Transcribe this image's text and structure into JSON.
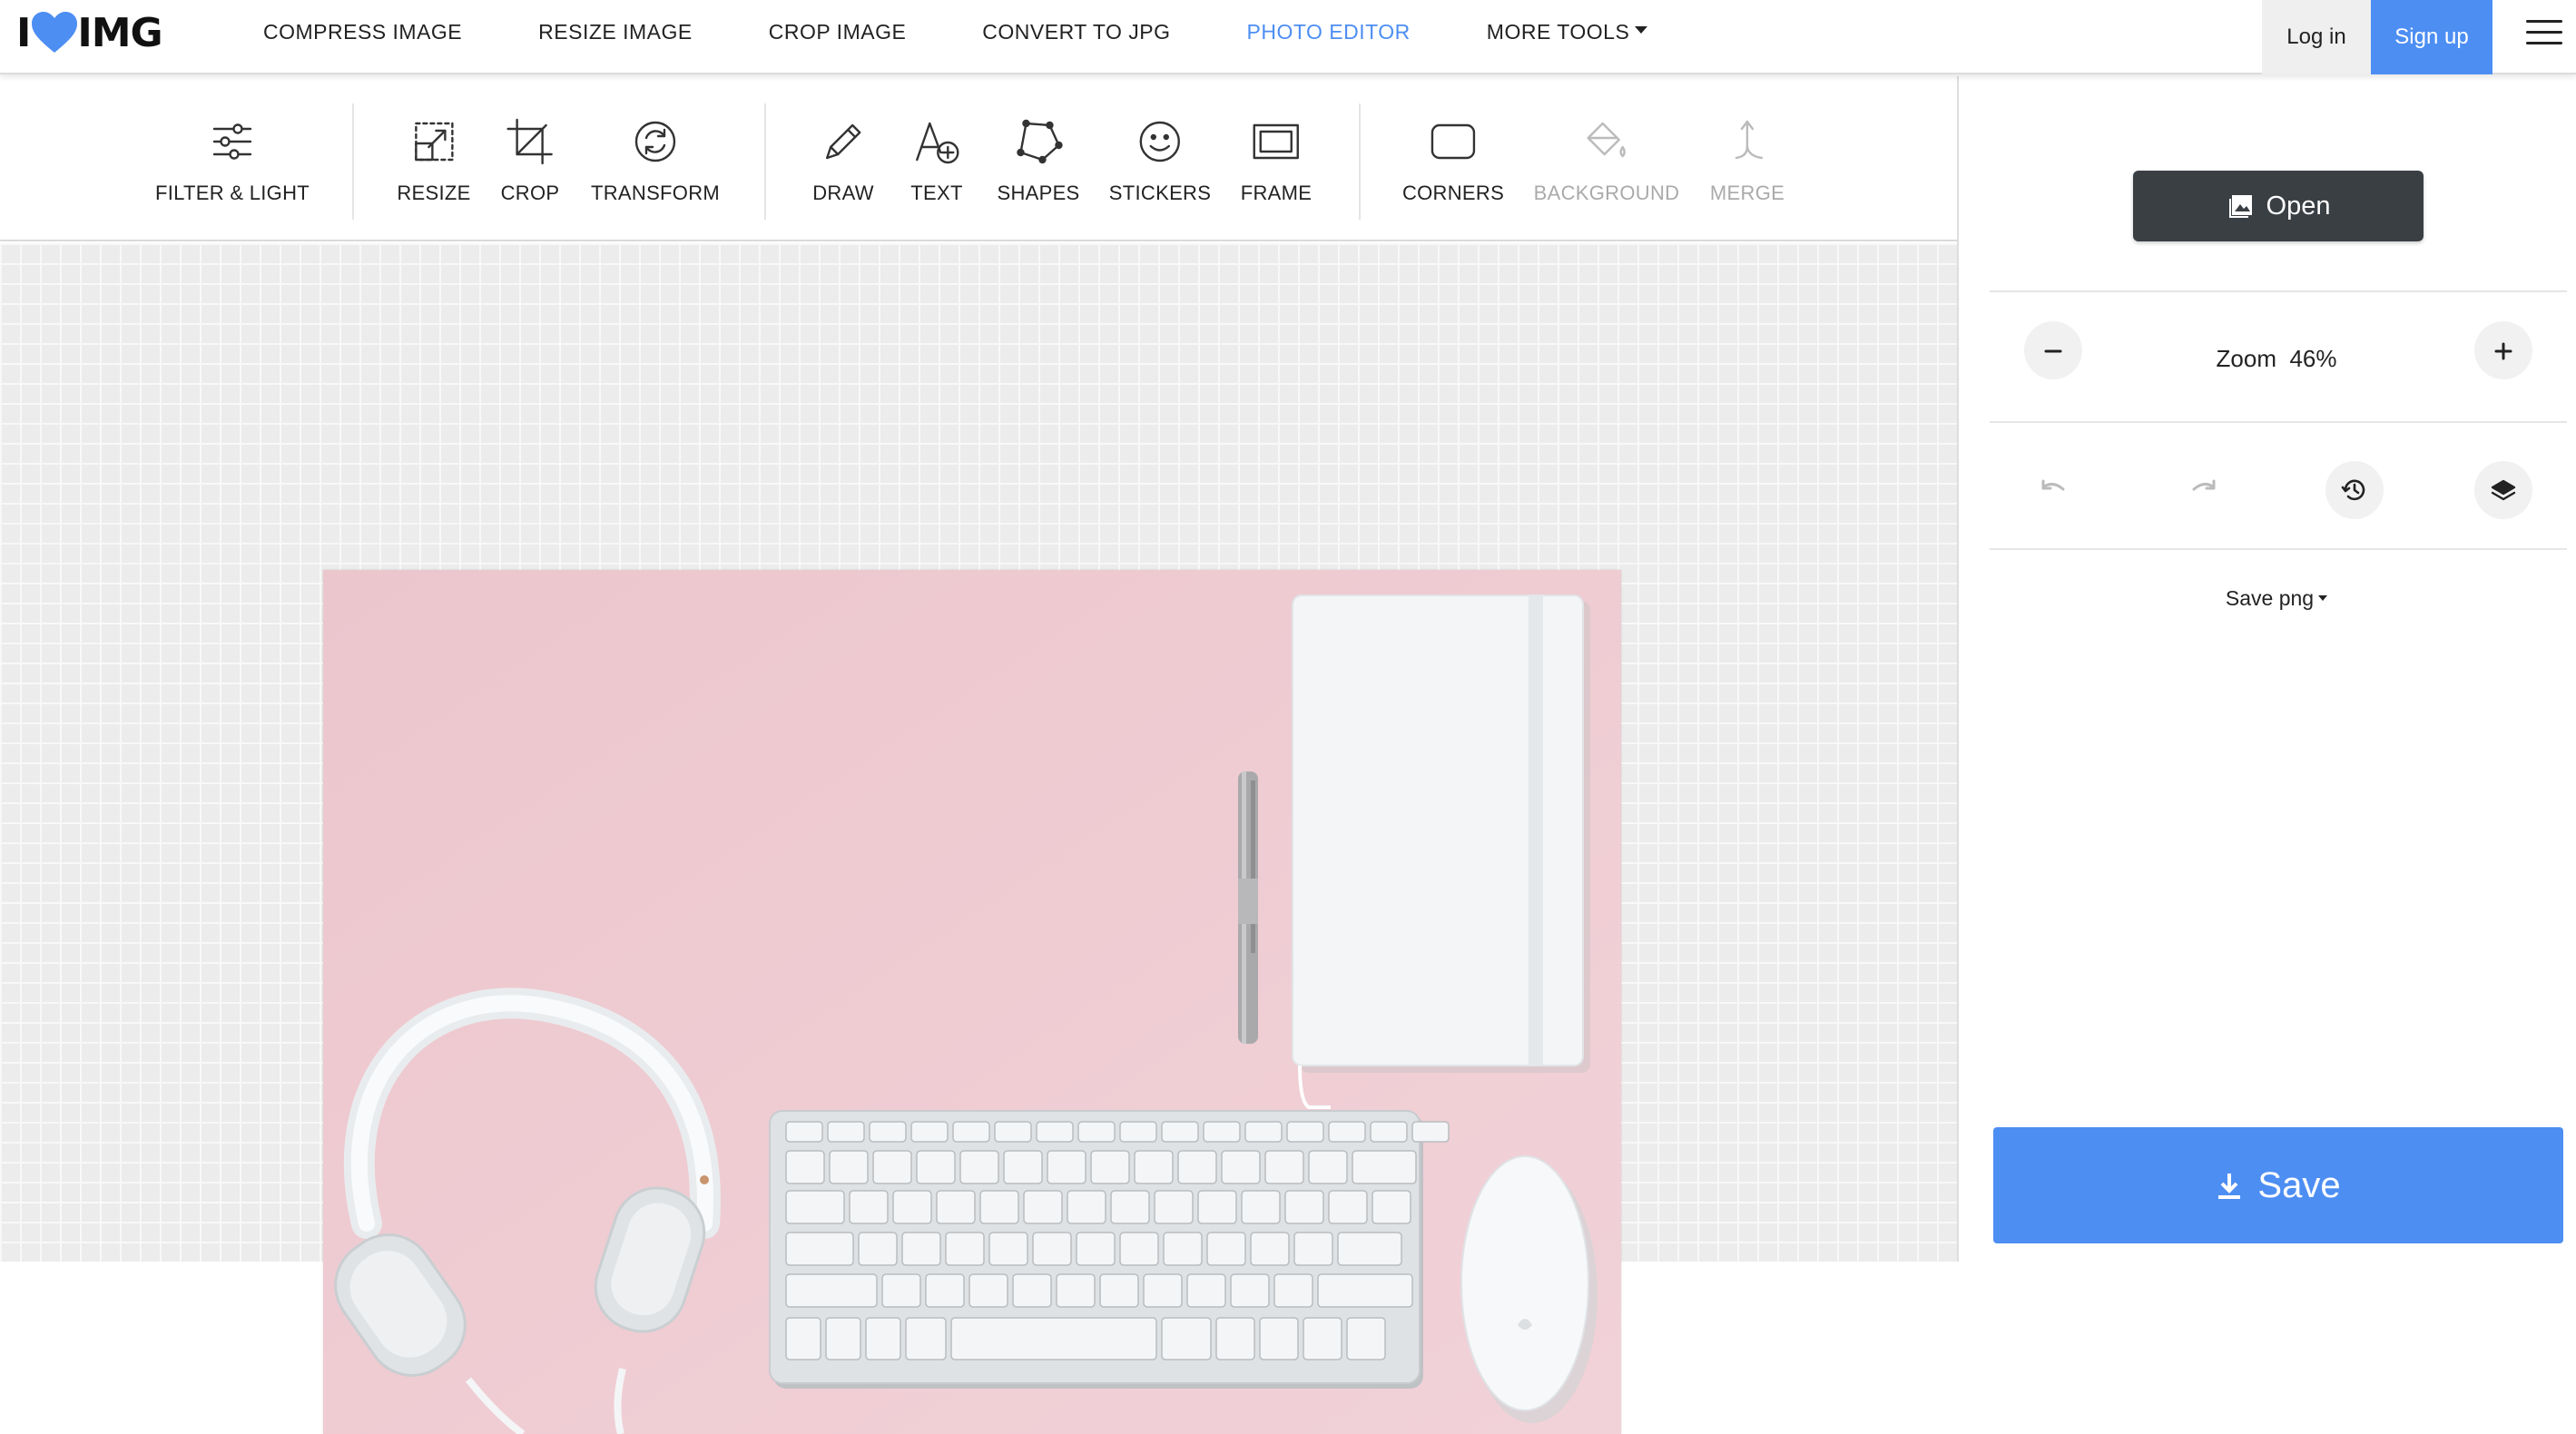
{
  "nav": {
    "logo_text": "IMG",
    "logo_prefix": "I",
    "links": [
      {
        "label": "COMPRESS IMAGE",
        "active": false
      },
      {
        "label": "RESIZE IMAGE",
        "active": false
      },
      {
        "label": "CROP IMAGE",
        "active": false
      },
      {
        "label": "CONVERT TO JPG",
        "active": false
      },
      {
        "label": "PHOTO EDITOR",
        "active": true
      },
      {
        "label": "MORE TOOLS",
        "active": false
      }
    ],
    "login_label": "Log in",
    "signup_label": "Sign up",
    "accent_color": "#4d8ef3"
  },
  "toolbar": {
    "tools": [
      {
        "label": "FILTER & LIGHT",
        "icon": "sliders-icon",
        "enabled": true
      },
      {
        "label": "RESIZE",
        "icon": "resize-icon",
        "enabled": true
      },
      {
        "label": "CROP",
        "icon": "crop-icon",
        "enabled": true
      },
      {
        "label": "TRANSFORM",
        "icon": "rotate-icon",
        "enabled": true
      },
      {
        "label": "DRAW",
        "icon": "pencil-icon",
        "enabled": true
      },
      {
        "label": "TEXT",
        "icon": "text-add-icon",
        "enabled": true
      },
      {
        "label": "SHAPES",
        "icon": "polygon-icon",
        "enabled": true
      },
      {
        "label": "STICKERS",
        "icon": "smiley-icon",
        "enabled": true
      },
      {
        "label": "FRAME",
        "icon": "frame-icon",
        "enabled": true
      },
      {
        "label": "CORNERS",
        "icon": "rounded-square-icon",
        "enabled": true
      },
      {
        "label": "BACKGROUND",
        "icon": "paint-bucket-icon",
        "enabled": false
      },
      {
        "label": "MERGE",
        "icon": "merge-icon",
        "enabled": false
      }
    ]
  },
  "panel": {
    "open_label": "Open",
    "zoom_label": "Zoom",
    "zoom_value": "46%",
    "save_format_label": "Save png",
    "save_label": "Save"
  }
}
